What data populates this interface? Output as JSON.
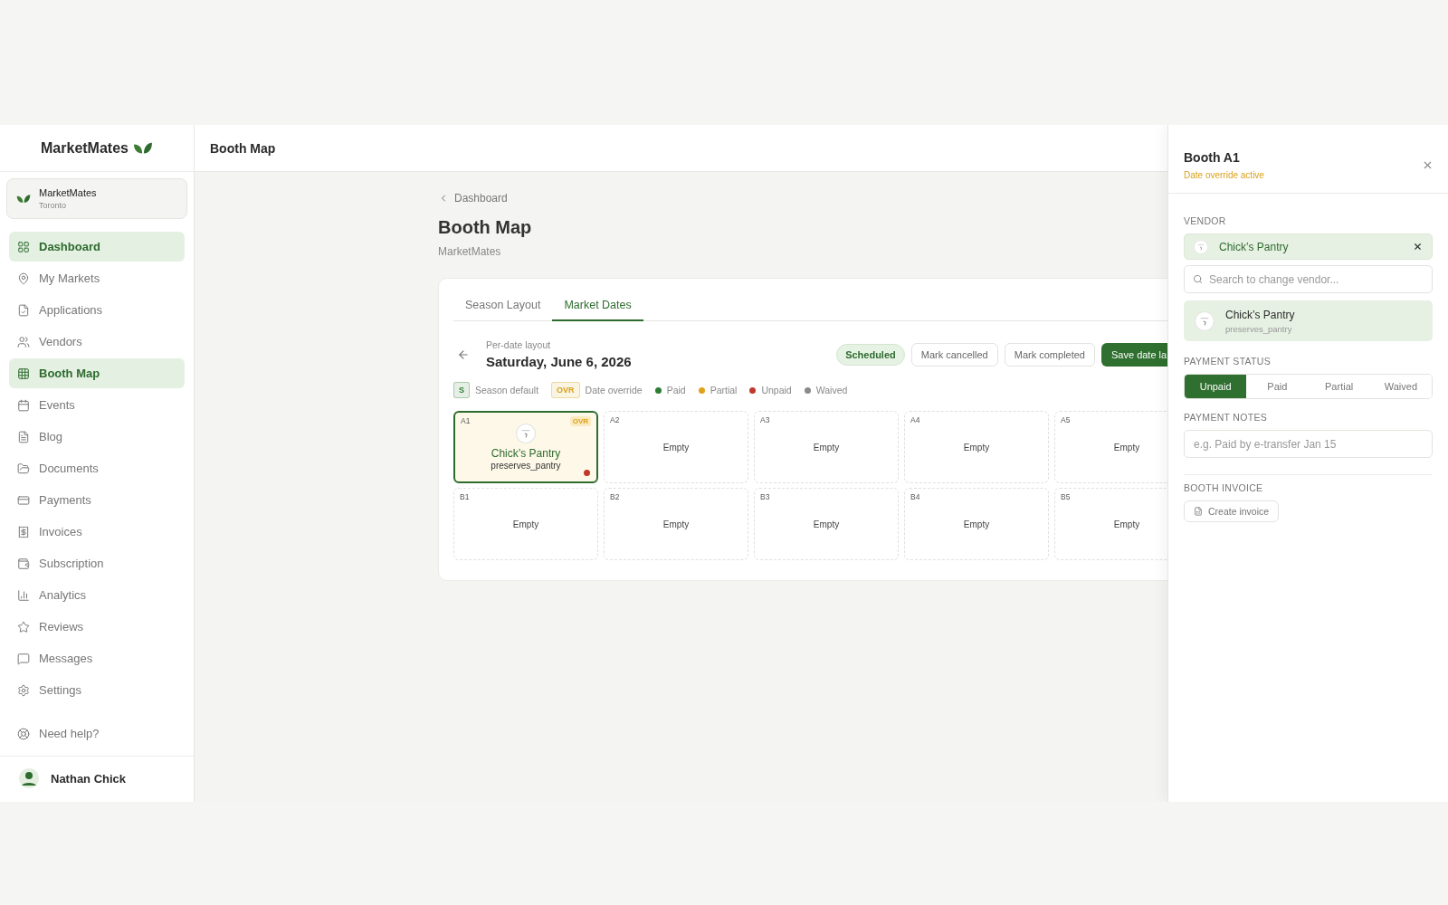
{
  "brand": {
    "name": "MarketMates"
  },
  "org": {
    "name": "MarketMates",
    "city": "Toronto"
  },
  "nav": [
    {
      "label": "Dashboard",
      "selected": true
    },
    {
      "label": "My Markets",
      "selected": false
    },
    {
      "label": "Applications",
      "selected": false
    },
    {
      "label": "Vendors",
      "selected": false
    },
    {
      "label": "Booth Map",
      "selected": true
    },
    {
      "label": "Events",
      "selected": false
    },
    {
      "label": "Blog",
      "selected": false
    },
    {
      "label": "Documents",
      "selected": false
    },
    {
      "label": "Payments",
      "selected": false
    },
    {
      "label": "Invoices",
      "selected": false
    },
    {
      "label": "Subscription",
      "selected": false
    },
    {
      "label": "Analytics",
      "selected": false
    },
    {
      "label": "Reviews",
      "selected": false
    },
    {
      "label": "Messages",
      "selected": false
    },
    {
      "label": "Settings",
      "selected": false
    }
  ],
  "help": {
    "label": "Need help?"
  },
  "user": {
    "name": "Nathan Chick"
  },
  "header": {
    "title": "Booth Map"
  },
  "page": {
    "breadcrumb": "Dashboard",
    "title": "Booth Map",
    "subtitle": "MarketMates"
  },
  "tabs": [
    {
      "label": "Season Layout",
      "selected": false
    },
    {
      "label": "Market Dates",
      "selected": true
    }
  ],
  "date_bar": {
    "caption": "Per-date layout",
    "date": "Saturday, June 6, 2026",
    "status": "Scheduled",
    "buttons": [
      "Mark cancelled",
      "Mark completed"
    ],
    "primary": "Save date la"
  },
  "legend": [
    {
      "kind": "badge",
      "badge": "S",
      "label": "Season default",
      "color": "#2e7d32"
    },
    {
      "kind": "badge",
      "badge": "OVR",
      "label": "Date override",
      "color": "#d9a21b"
    },
    {
      "kind": "dot",
      "label": "Paid",
      "color": "#2e7d32"
    },
    {
      "kind": "dot",
      "label": "Partial",
      "color": "#e0a21a"
    },
    {
      "kind": "dot",
      "label": "Unpaid",
      "color": "#c0392b"
    },
    {
      "kind": "dot",
      "label": "Waived",
      "color": "#8a8a8a"
    }
  ],
  "booths": [
    {
      "label": "A1",
      "kind": "assigned",
      "selected": true,
      "badge": "OVR",
      "vendor": "Chick’s Pantry",
      "handle": "preserves_pantry",
      "color": "#c0392b"
    },
    {
      "label": "A2",
      "kind": "empty",
      "selected": false,
      "text": "Empty"
    },
    {
      "label": "A3",
      "kind": "empty",
      "selected": false,
      "text": "Empty"
    },
    {
      "label": "A4",
      "kind": "empty",
      "selected": false,
      "text": "Empty"
    },
    {
      "label": "A5",
      "kind": "empty",
      "selected": false,
      "text": "Empty"
    },
    {
      "label": "B1",
      "kind": "empty",
      "selected": false,
      "text": "Empty"
    },
    {
      "label": "B2",
      "kind": "empty",
      "selected": false,
      "text": "Empty"
    },
    {
      "label": "B3",
      "kind": "empty",
      "selected": false,
      "text": "Empty"
    },
    {
      "label": "B4",
      "kind": "empty",
      "selected": false,
      "text": "Empty"
    },
    {
      "label": "B5",
      "kind": "empty",
      "selected": false,
      "text": "Empty"
    }
  ],
  "panel": {
    "title": "Booth A1",
    "subtitle": "Date override active",
    "vendor_label": "VENDOR",
    "vendor": "Chick’s Pantry",
    "search_placeholder": "Search to change vendor...",
    "results": [
      {
        "name": "Chick’s Pantry",
        "handle": "preserves_pantry"
      }
    ],
    "status_label": "PAYMENT STATUS",
    "statuses": [
      {
        "label": "Unpaid",
        "selected": true
      },
      {
        "label": "Paid",
        "selected": false
      },
      {
        "label": "Partial",
        "selected": false
      },
      {
        "label": "Waived",
        "selected": false
      }
    ],
    "notes_label": "PAYMENT NOTES",
    "notes_placeholder": "e.g. Paid by e-transfer Jan 15",
    "invoice_label": "BOOTH INVOICE",
    "invoice_button": "Create invoice"
  }
}
